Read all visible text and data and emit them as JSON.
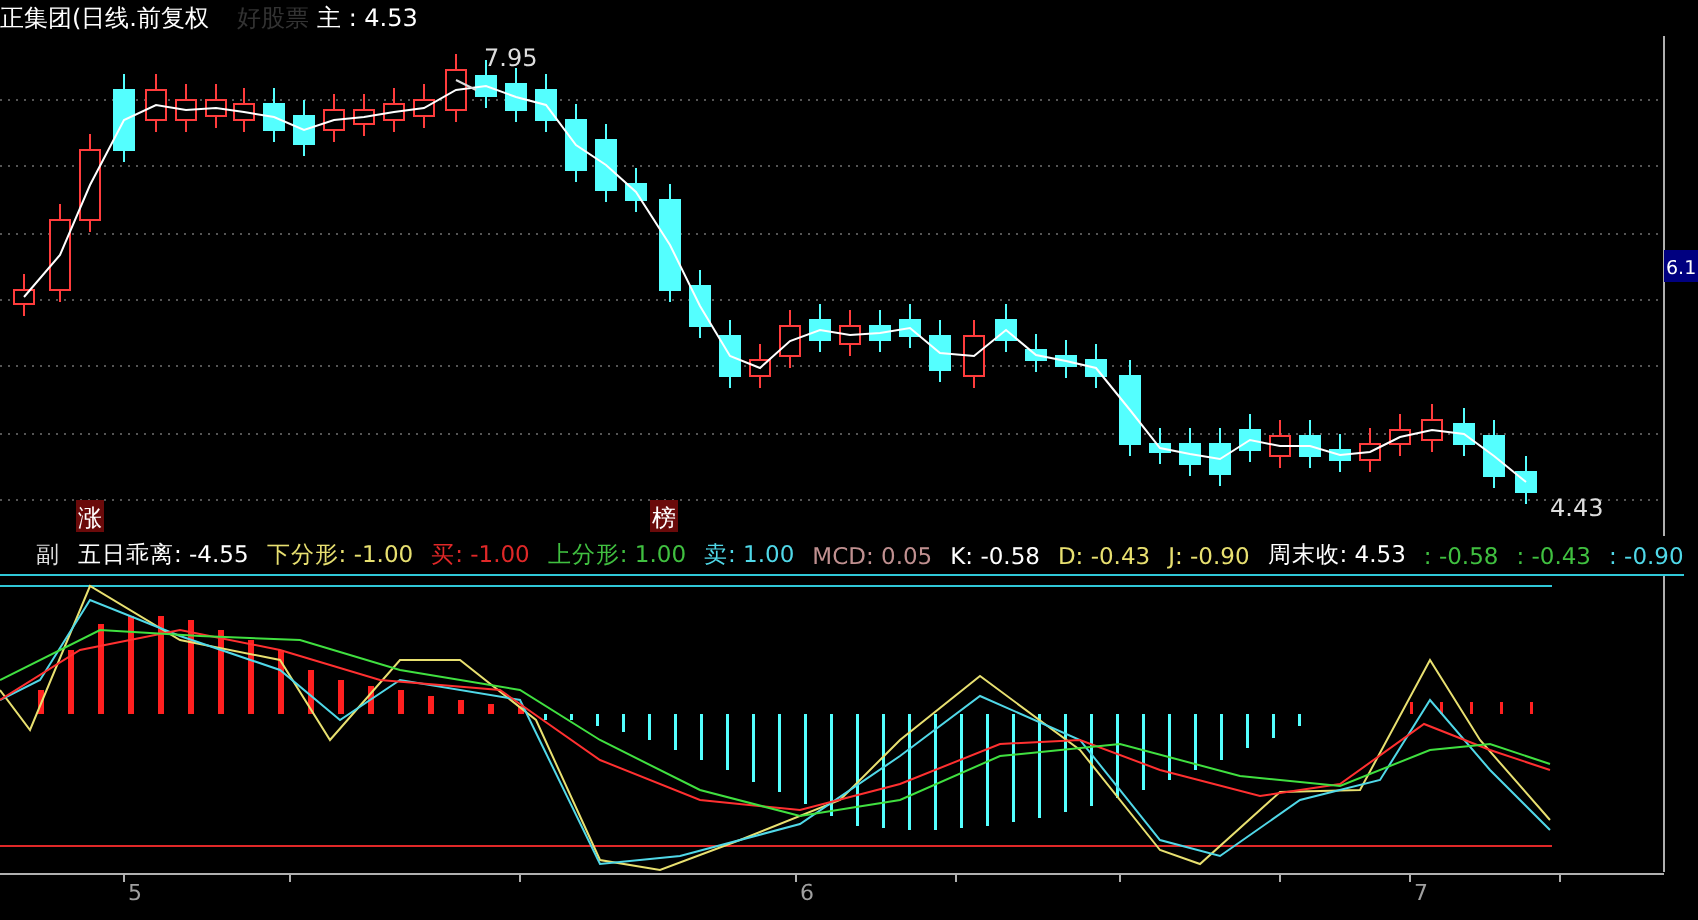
{
  "header": {
    "title": "正集团(日线.前复权",
    "dim_label": "好股票",
    "main_reading": "主 : 4.53"
  },
  "price_chart": {
    "high_label": "7.95",
    "low_label": "4.43",
    "axis_tag": "6.1",
    "event_tags": [
      "涨",
      "榜"
    ]
  },
  "indicator": {
    "panel_label": "副",
    "readings": [
      {
        "text": "五日乖离: -4.55",
        "color": "#ffffff"
      },
      {
        "text": "下分形: -1.00",
        "color": "#e8e070"
      },
      {
        "text": "买: -1.00",
        "color": "#e02828"
      },
      {
        "text": "上分形: 1.00",
        "color": "#40c040"
      },
      {
        "text": "卖: 1.00",
        "color": "#50d8e8"
      },
      {
        "text": "MCD: 0.05",
        "color": "#c09090"
      },
      {
        "text": "K: -0.58",
        "color": "#ffffff"
      },
      {
        "text": "D: -0.43",
        "color": "#e8e070"
      },
      {
        "text": "J: -0.90",
        "color": "#e8e070"
      },
      {
        "text": "周末收: 4.53",
        "color": "#ffffff"
      },
      {
        "text": ": -0.58",
        "color": "#40c040"
      },
      {
        "text": ": -0.43",
        "color": "#40c040"
      },
      {
        "text": ": -0.90",
        "color": "#50d8e8"
      }
    ]
  },
  "date_axis": {
    "months": [
      "5",
      "6",
      "7"
    ]
  }
}
